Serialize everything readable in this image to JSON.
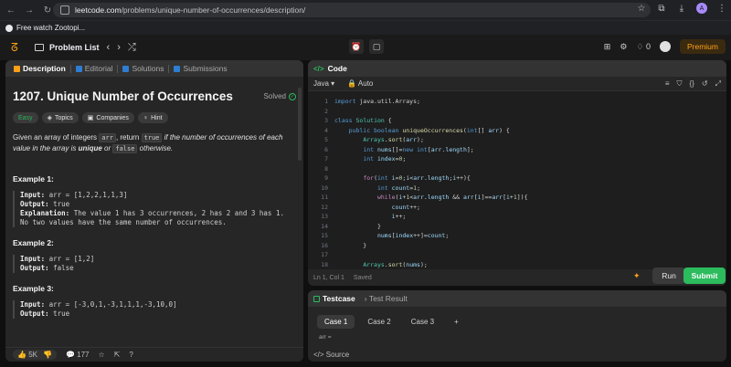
{
  "browser": {
    "url_host": "leetcode.com",
    "url_path": "/problems/unique-number-of-occurrences/description/",
    "profile_initial": "A",
    "bookmark": "Free watch Zootopi..."
  },
  "header": {
    "problem_list": "Problem List",
    "coins": "0",
    "premium": "Premium"
  },
  "left": {
    "tabs": [
      "Description",
      "Editorial",
      "Solutions",
      "Submissions"
    ],
    "title": "1207. Unique Number of Occurrences",
    "solved": "Solved",
    "tags": [
      "Easy",
      "Topics",
      "Companies",
      "Hint"
    ],
    "desc": {
      "p1": "Given an array of integers ",
      "c1": "arr",
      "p2": ", return ",
      "c2": "true",
      "p3": " if the number of occurrences of each value in the array is ",
      "b1": "unique",
      "p4": " or ",
      "c3": "false",
      "p5": " otherwise."
    },
    "examples": [
      {
        "heading": "Example 1:",
        "input_label": "Input:",
        "input": " arr = [1,2,2,1,1,3]",
        "output_label": "Output:",
        "output": " true",
        "expl_label": "Explanation:",
        "expl": " The value 1 has 3 occurrences, 2 has 2 and 3 has 1.",
        "expl2": "No two values have the same number of occurrences."
      },
      {
        "heading": "Example 2:",
        "input_label": "Input:",
        "input": " arr = [1,2]",
        "output_label": "Output:",
        "output": " false"
      },
      {
        "heading": "Example 3:",
        "input_label": "Input:",
        "input": " arr = [-3,0,1,-3,1,1,1,-3,10,0]",
        "output_label": "Output:",
        "output": " true"
      }
    ],
    "footer": {
      "likes": "5K",
      "comments": "177"
    }
  },
  "code": {
    "tab": "Code",
    "language": "Java",
    "auto": "Auto",
    "status_pos": "Ln 1, Col 1",
    "status_saved": "Saved",
    "run": "Run",
    "submit": "Submit"
  },
  "test": {
    "tabs": [
      "Testcase",
      "Test Result"
    ],
    "cases": [
      "Case 1",
      "Case 2",
      "Case 3"
    ],
    "arr_label": "arr =",
    "source": "Source"
  }
}
